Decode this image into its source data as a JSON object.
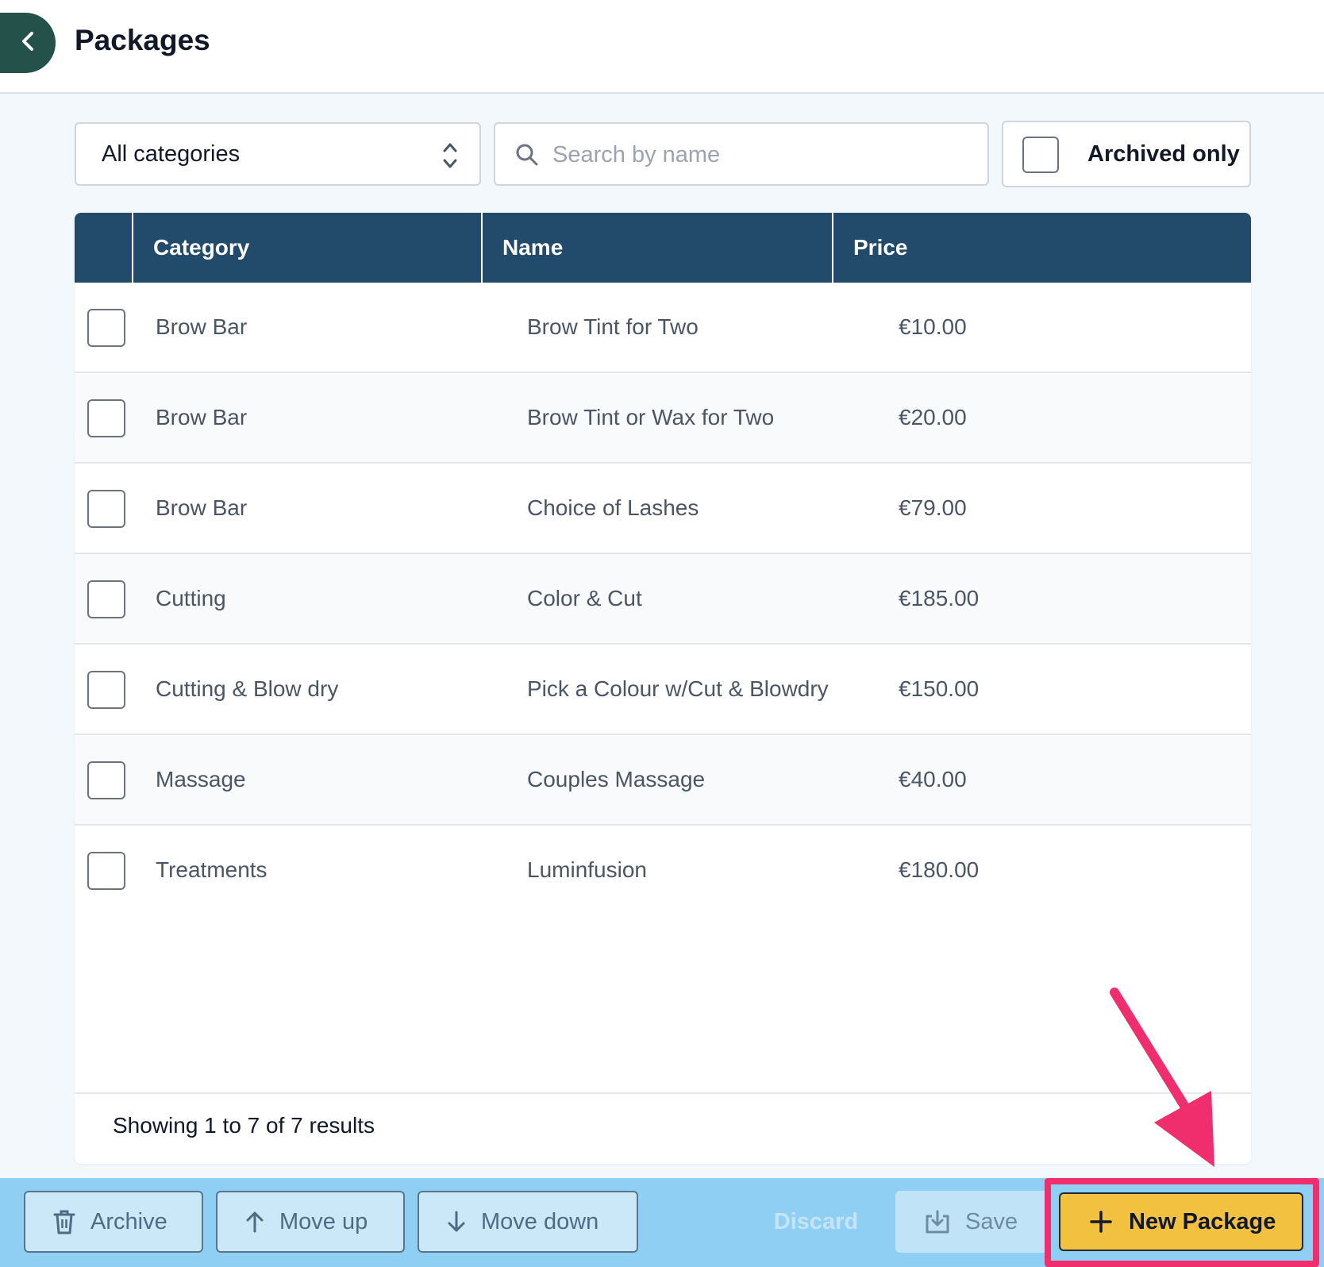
{
  "header": {
    "title": "Packages"
  },
  "filters": {
    "category_value": "All categories",
    "search_placeholder": "Search by name",
    "archived_label": "Archived only"
  },
  "table": {
    "columns": [
      "Category",
      "Name",
      "Price"
    ],
    "rows": [
      {
        "category": "Brow Bar",
        "name": "Brow Tint for Two",
        "price": "€10.00"
      },
      {
        "category": "Brow Bar",
        "name": "Brow Tint or Wax for Two",
        "price": "€20.00"
      },
      {
        "category": "Brow Bar",
        "name": "Choice of Lashes",
        "price": "€79.00"
      },
      {
        "category": "Cutting",
        "name": "Color & Cut",
        "price": "€185.00"
      },
      {
        "category": "Cutting & Blow dry",
        "name": "Pick a Colour w/Cut & Blowdry",
        "price": "€150.00"
      },
      {
        "category": "Massage",
        "name": "Couples Massage",
        "price": "€40.00"
      },
      {
        "category": "Treatments",
        "name": "Luminfusion",
        "price": "€180.00"
      }
    ],
    "results_text": "Showing 1 to 7 of 7 results"
  },
  "actions": {
    "archive": "Archive",
    "move_up": "Move up",
    "move_down": "Move down",
    "discard": "Discard",
    "save": "Save",
    "new_package": "New Package"
  },
  "colors": {
    "header_bg": "#224a6a",
    "back_button": "#24514a",
    "action_bar": "#8ecff3",
    "primary_button": "#f2c13f",
    "annotation": "#f02d6d"
  }
}
